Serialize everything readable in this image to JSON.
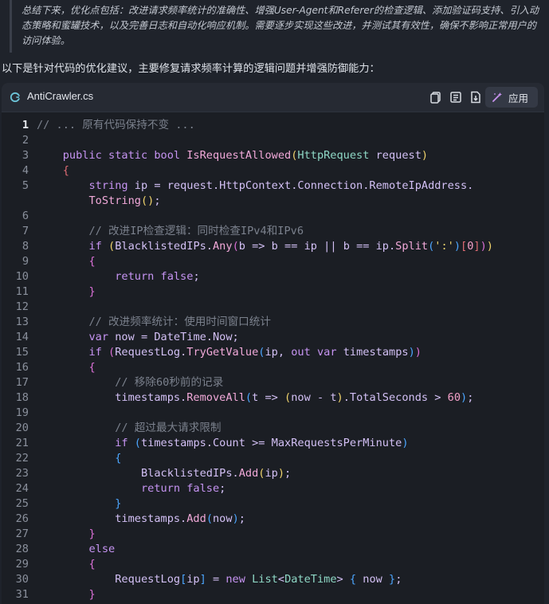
{
  "quote": {
    "text": "总结下来，优化点包括：改进请求频率统计的准确性、增强User-Agent和Referer的检查逻辑、添加验证码支持、引入动态策略和蜜罐技术，以及完善日志和自动化响应机制。需要逐步实现这些改进，并测试其有效性，确保不影响正常用户的访问体验。"
  },
  "intro": "以下是针对代码的优化建议，主要修复请求频率计算的逻辑问题并增强防御能力：",
  "card": {
    "file_name": "AntiCrawler.cs",
    "apply_label": "应用",
    "icons": [
      "csharp-file-icon",
      "copy-icon",
      "wrap-icon",
      "download-icon",
      "magic-wand-icon"
    ]
  },
  "code": {
    "active_line": 1,
    "lines": [
      {
        "n": "1",
        "t": [
          [
            "c-cm",
            "// ... 原有代码保持不变 ..."
          ]
        ]
      },
      {
        "n": "2",
        "t": []
      },
      {
        "n": "3",
        "t": [
          [
            "",
            "    "
          ],
          [
            "c-kw",
            "public static bool "
          ],
          [
            "c-fn",
            "IsRequestAllowed"
          ],
          [
            "c-y",
            "("
          ],
          [
            "c-ty",
            "HttpRequest"
          ],
          [
            "c-pl",
            " request"
          ],
          [
            "c-y",
            ")"
          ]
        ]
      },
      {
        "n": "4",
        "t": [
          [
            "",
            "    "
          ],
          [
            "c-r",
            "{"
          ]
        ]
      },
      {
        "n": "5",
        "t": [
          [
            "",
            "        "
          ],
          [
            "c-kw",
            "string "
          ],
          [
            "c-pl",
            "ip = request.HttpContext.Connection.RemoteIpAddress."
          ]
        ]
      },
      {
        "n": "",
        "t": [
          [
            "",
            "        "
          ],
          [
            "c-fn",
            "ToString"
          ],
          [
            "c-y",
            "()"
          ],
          [
            "c-pl",
            ";"
          ]
        ]
      },
      {
        "n": "6",
        "t": []
      },
      {
        "n": "7",
        "t": [
          [
            "",
            "        "
          ],
          [
            "c-cm",
            "// 改进IP检查逻辑：同时检查IPv4和IPv6"
          ]
        ]
      },
      {
        "n": "8",
        "t": [
          [
            "",
            "        "
          ],
          [
            "c-kw",
            "if "
          ],
          [
            "c-y",
            "("
          ],
          [
            "c-pl",
            "BlacklistedIPs."
          ],
          [
            "c-fn",
            "Any"
          ],
          [
            "c-p",
            "("
          ],
          [
            "c-pl",
            "b => b == ip || b == ip."
          ],
          [
            "c-fn",
            "Split"
          ],
          [
            "c-b",
            "("
          ],
          [
            "c-s",
            "':'"
          ],
          [
            "c-b",
            ")"
          ],
          [
            "c-r",
            "["
          ],
          [
            "c-n",
            "0"
          ],
          [
            "c-r",
            "]"
          ],
          [
            "c-p",
            ")"
          ],
          [
            "c-y",
            ")"
          ]
        ]
      },
      {
        "n": "9",
        "t": [
          [
            "",
            "        "
          ],
          [
            "c-p",
            "{"
          ]
        ]
      },
      {
        "n": "10",
        "t": [
          [
            "",
            "            "
          ],
          [
            "c-kw",
            "return false"
          ],
          [
            "c-pl",
            ";"
          ]
        ]
      },
      {
        "n": "11",
        "t": [
          [
            "",
            "        "
          ],
          [
            "c-p",
            "}"
          ]
        ]
      },
      {
        "n": "12",
        "t": []
      },
      {
        "n": "13",
        "t": [
          [
            "",
            "        "
          ],
          [
            "c-cm",
            "// 改进频率统计：使用时间窗口统计"
          ]
        ]
      },
      {
        "n": "14",
        "t": [
          [
            "",
            "        "
          ],
          [
            "c-kw",
            "var "
          ],
          [
            "c-pl",
            "now = DateTime.Now;"
          ]
        ]
      },
      {
        "n": "15",
        "t": [
          [
            "",
            "        "
          ],
          [
            "c-kw",
            "if "
          ],
          [
            "c-p",
            "("
          ],
          [
            "c-pl",
            "RequestLog."
          ],
          [
            "c-fn",
            "TryGetValue"
          ],
          [
            "c-b",
            "("
          ],
          [
            "c-pl",
            "ip, "
          ],
          [
            "c-kw",
            "out var "
          ],
          [
            "c-pl",
            "timestamps"
          ],
          [
            "c-b",
            ")"
          ],
          [
            "c-p",
            ")"
          ]
        ]
      },
      {
        "n": "16",
        "t": [
          [
            "",
            "        "
          ],
          [
            "c-p",
            "{"
          ]
        ]
      },
      {
        "n": "17",
        "t": [
          [
            "",
            "            "
          ],
          [
            "c-cm",
            "// 移除60秒前的记录"
          ]
        ]
      },
      {
        "n": "18",
        "t": [
          [
            "",
            "            "
          ],
          [
            "c-pl",
            "timestamps."
          ],
          [
            "c-fn",
            "RemoveAll"
          ],
          [
            "c-b",
            "("
          ],
          [
            "c-pl",
            "t => "
          ],
          [
            "c-y",
            "("
          ],
          [
            "c-pl",
            "now - t"
          ],
          [
            "c-y",
            ")"
          ],
          [
            "c-pl",
            ".TotalSeconds > "
          ],
          [
            "c-n",
            "60"
          ],
          [
            "c-b",
            ")"
          ],
          [
            "c-pl",
            ";"
          ]
        ]
      },
      {
        "n": "19",
        "t": []
      },
      {
        "n": "20",
        "t": [
          [
            "",
            "            "
          ],
          [
            "c-cm",
            "// 超过最大请求限制"
          ]
        ]
      },
      {
        "n": "21",
        "t": [
          [
            "",
            "            "
          ],
          [
            "c-kw",
            "if "
          ],
          [
            "c-b",
            "("
          ],
          [
            "c-pl",
            "timestamps.Count >= MaxRequestsPerMinute"
          ],
          [
            "c-b",
            ")"
          ]
        ]
      },
      {
        "n": "22",
        "t": [
          [
            "",
            "            "
          ],
          [
            "c-b",
            "{"
          ]
        ]
      },
      {
        "n": "23",
        "t": [
          [
            "",
            "                "
          ],
          [
            "c-pl",
            "BlacklistedIPs."
          ],
          [
            "c-fn",
            "Add"
          ],
          [
            "c-y",
            "("
          ],
          [
            "c-pl",
            "ip"
          ],
          [
            "c-y",
            ")"
          ],
          [
            "c-pl",
            ";"
          ]
        ]
      },
      {
        "n": "24",
        "t": [
          [
            "",
            "                "
          ],
          [
            "c-kw",
            "return false"
          ],
          [
            "c-pl",
            ";"
          ]
        ]
      },
      {
        "n": "25",
        "t": [
          [
            "",
            "            "
          ],
          [
            "c-b",
            "}"
          ]
        ]
      },
      {
        "n": "26",
        "t": [
          [
            "",
            "            "
          ],
          [
            "c-pl",
            "timestamps."
          ],
          [
            "c-fn",
            "Add"
          ],
          [
            "c-b",
            "("
          ],
          [
            "c-pl",
            "now"
          ],
          [
            "c-b",
            ")"
          ],
          [
            "c-pl",
            ";"
          ]
        ]
      },
      {
        "n": "27",
        "t": [
          [
            "",
            "        "
          ],
          [
            "c-p",
            "}"
          ]
        ]
      },
      {
        "n": "28",
        "t": [
          [
            "",
            "        "
          ],
          [
            "c-kw",
            "else"
          ]
        ]
      },
      {
        "n": "29",
        "t": [
          [
            "",
            "        "
          ],
          [
            "c-p",
            "{"
          ]
        ]
      },
      {
        "n": "30",
        "t": [
          [
            "",
            "            "
          ],
          [
            "c-pl",
            "RequestLog"
          ],
          [
            "c-b",
            "["
          ],
          [
            "c-pl",
            "ip"
          ],
          [
            "c-b",
            "]"
          ],
          [
            "c-pl",
            " = "
          ],
          [
            "c-kw",
            "new "
          ],
          [
            "c-ty",
            "List"
          ],
          [
            "c-pl",
            "<"
          ],
          [
            "c-ty",
            "DateTime"
          ],
          [
            "c-pl",
            "> "
          ],
          [
            "c-b",
            "{"
          ],
          [
            "c-pl",
            " now "
          ],
          [
            "c-b",
            "}"
          ],
          [
            "c-pl",
            ";"
          ]
        ]
      },
      {
        "n": "31",
        "t": [
          [
            "",
            "        "
          ],
          [
            "c-p",
            "}"
          ]
        ]
      }
    ]
  }
}
